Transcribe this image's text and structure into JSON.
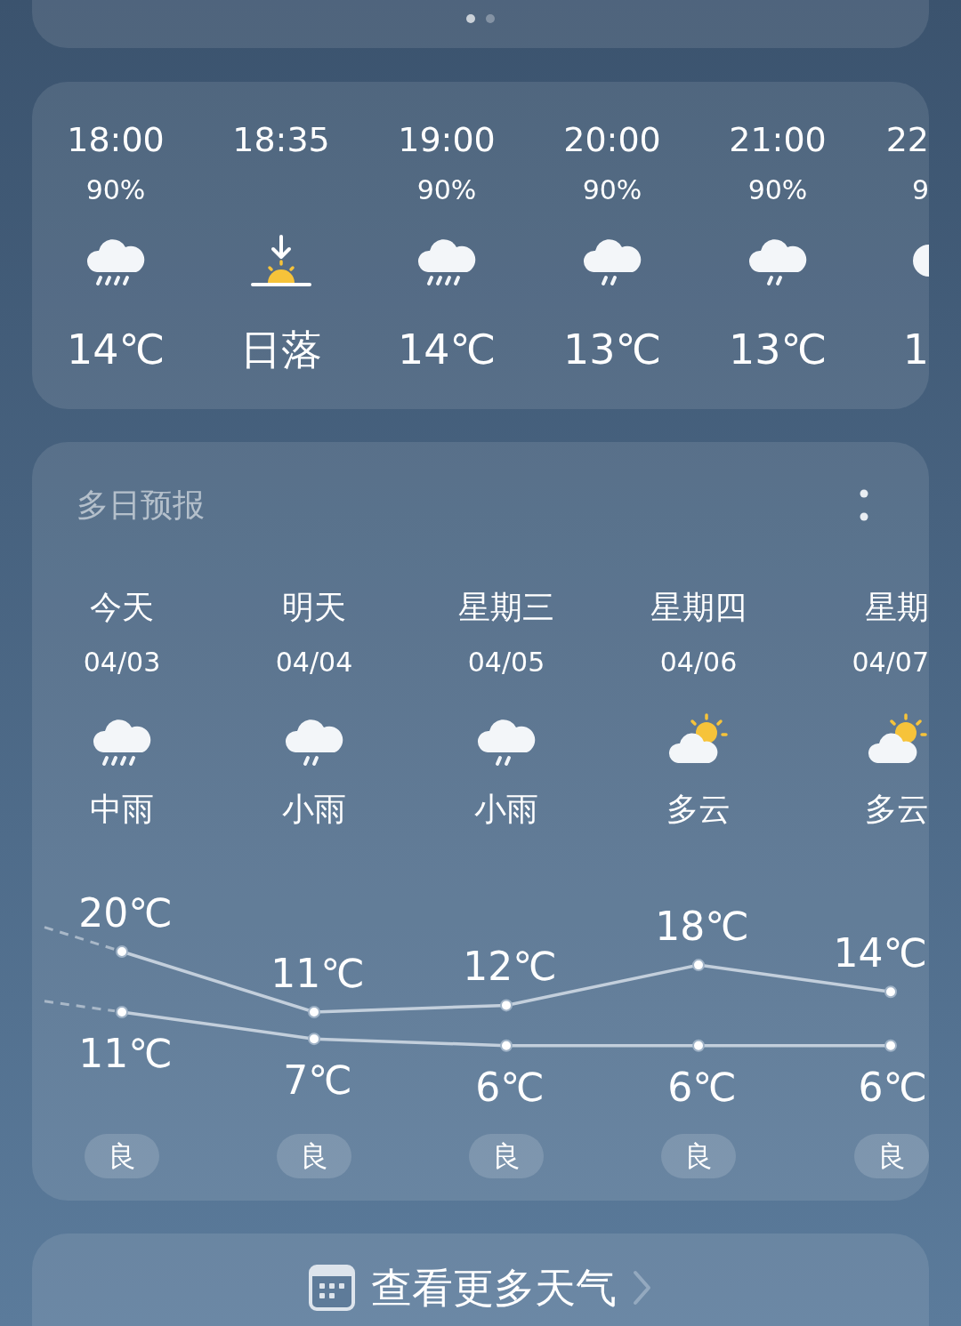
{
  "page_dots": [
    {
      "selected": true
    },
    {
      "selected": false
    }
  ],
  "hourly": [
    {
      "time": "18:00",
      "precip": "90%",
      "kind": "heavy_rain",
      "temp": "14℃"
    },
    {
      "time": "18:35",
      "kind": "sunset",
      "temp": "日落"
    },
    {
      "time": "19:00",
      "precip": "90%",
      "kind": "heavy_rain",
      "temp": "14℃"
    },
    {
      "time": "20:00",
      "precip": "90%",
      "kind": "light_rain",
      "temp": "13℃"
    },
    {
      "time": "21:00",
      "precip": "90%",
      "kind": "light_rain",
      "temp": "13℃"
    },
    {
      "time": "22",
      "precip": "9",
      "kind": "cloud_edge",
      "temp": "1"
    }
  ],
  "forecast": {
    "title": "多日预报",
    "days": [
      {
        "day": "今天",
        "date": "04/03",
        "kind": "heavy_rain",
        "condition": "中雨",
        "air": "良"
      },
      {
        "day": "明天",
        "date": "04/04",
        "kind": "light_rain",
        "condition": "小雨",
        "air": "良"
      },
      {
        "day": "星期三",
        "date": "04/05",
        "kind": "light_rain",
        "condition": "小雨",
        "air": "良"
      },
      {
        "day": "星期四",
        "date": "04/06",
        "kind": "partly_cloudy",
        "condition": "多云",
        "air": "良"
      },
      {
        "day": "星期",
        "date": "04/07",
        "kind": "partly_cloudy",
        "condition": "多云",
        "air": "良"
      }
    ],
    "chart_data": {
      "type": "line",
      "categories": [
        null,
        null,
        null,
        null,
        null
      ],
      "series": [
        {
          "color": "#c3cfdc",
          "marker": "circle",
          "values": [
            20,
            11,
            12,
            18,
            14
          ],
          "value_labels": [
            "20℃",
            "11℃",
            "12℃",
            "18℃",
            "14℃"
          ]
        },
        {
          "color": "#c3cfdc",
          "marker": "circle",
          "values": [
            11,
            7,
            6,
            6,
            6
          ],
          "value_labels": [
            "11℃",
            "7℃",
            "6℃",
            "6℃",
            "6℃"
          ]
        }
      ]
    }
  },
  "more_button": {
    "label": "查看更多天气"
  }
}
